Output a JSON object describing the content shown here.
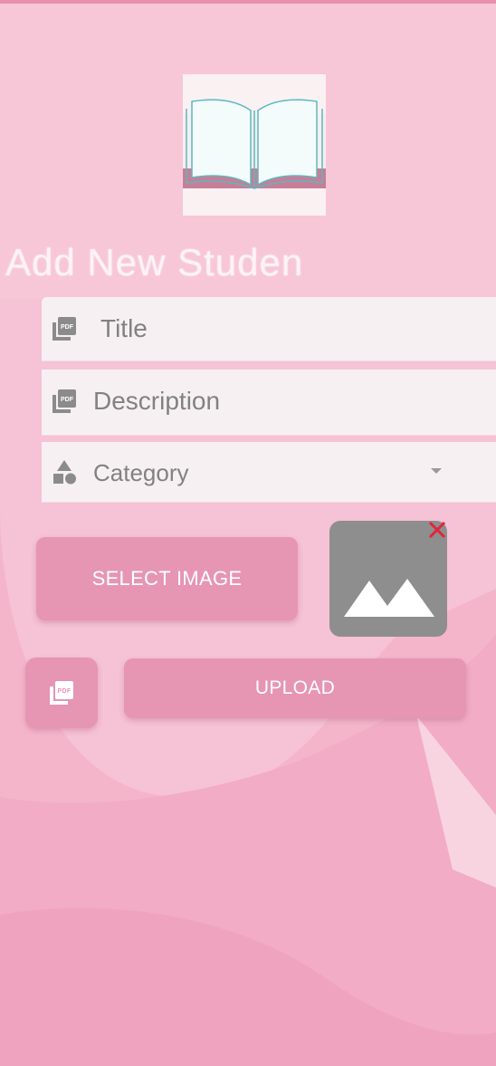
{
  "page": {
    "heading": "Add New Studen",
    "logo_icon": "open-book-icon"
  },
  "form": {
    "title_placeholder": "Title",
    "title_icon": "pdf-icon",
    "description_placeholder": "Description",
    "description_icon": "pdf-icon",
    "category_placeholder": "Category",
    "category_icon": "category-shapes-icon",
    "category_dropdown_icon": "chevron-down-icon"
  },
  "actions": {
    "select_image_label": "SELECT IMAGE",
    "upload_label": "UPLOAD",
    "pdf_button_icon": "pdf-icon",
    "remove_image_icon": "close-icon",
    "image_placeholder_icon": "image-icon"
  },
  "colors": {
    "primary": "#e695b3",
    "background": "#f6bfd3",
    "field_bg": "#f7f0f2",
    "remove_icon": "#e0263a",
    "placeholder_image": "#8e8e8e"
  }
}
